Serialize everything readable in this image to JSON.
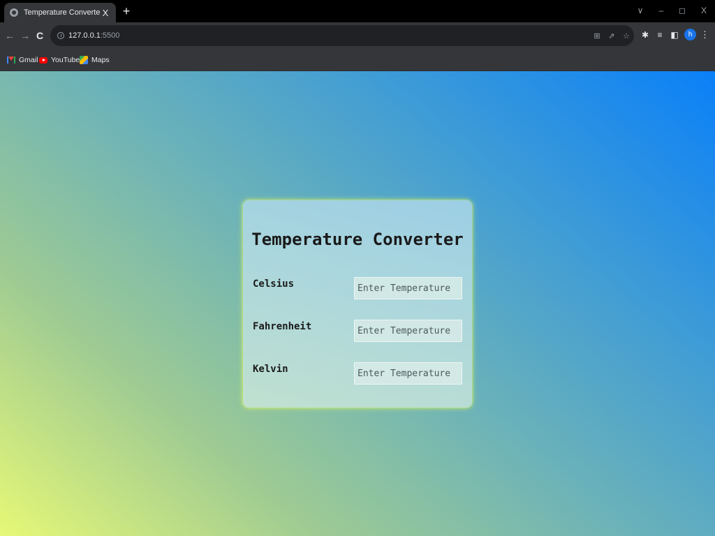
{
  "browser": {
    "tab_title": "Temperature Converter",
    "tab_close": "X",
    "new_tab": "+",
    "window_controls": {
      "menu": "∨",
      "minimize": "–",
      "restore": "◻",
      "close": "X"
    },
    "nav": {
      "back": "←",
      "forward": "→",
      "reload": "C"
    },
    "url_host": "127.0.0.1",
    "url_port": ":5500",
    "avatar_letter": "h",
    "bookmarks": [
      {
        "label": "Gmail",
        "icon": "gmail-icon"
      },
      {
        "label": "YouTube",
        "icon": "youtube-icon"
      },
      {
        "label": "Maps",
        "icon": "maps-icon"
      }
    ]
  },
  "converter": {
    "title": "Temperature Converter",
    "fields": [
      {
        "label": "Celsius",
        "value": "",
        "placeholder": "Enter Temperature"
      },
      {
        "label": "Fahrenheit",
        "value": "",
        "placeholder": "Enter Temperature"
      },
      {
        "label": "Kelvin",
        "value": "",
        "placeholder": "Enter Temperature"
      }
    ]
  },
  "colors": {
    "gradient_top_right": "#0a80f8",
    "gradient_bottom_left": "#e6f876",
    "card_glow": "#dcf564"
  }
}
